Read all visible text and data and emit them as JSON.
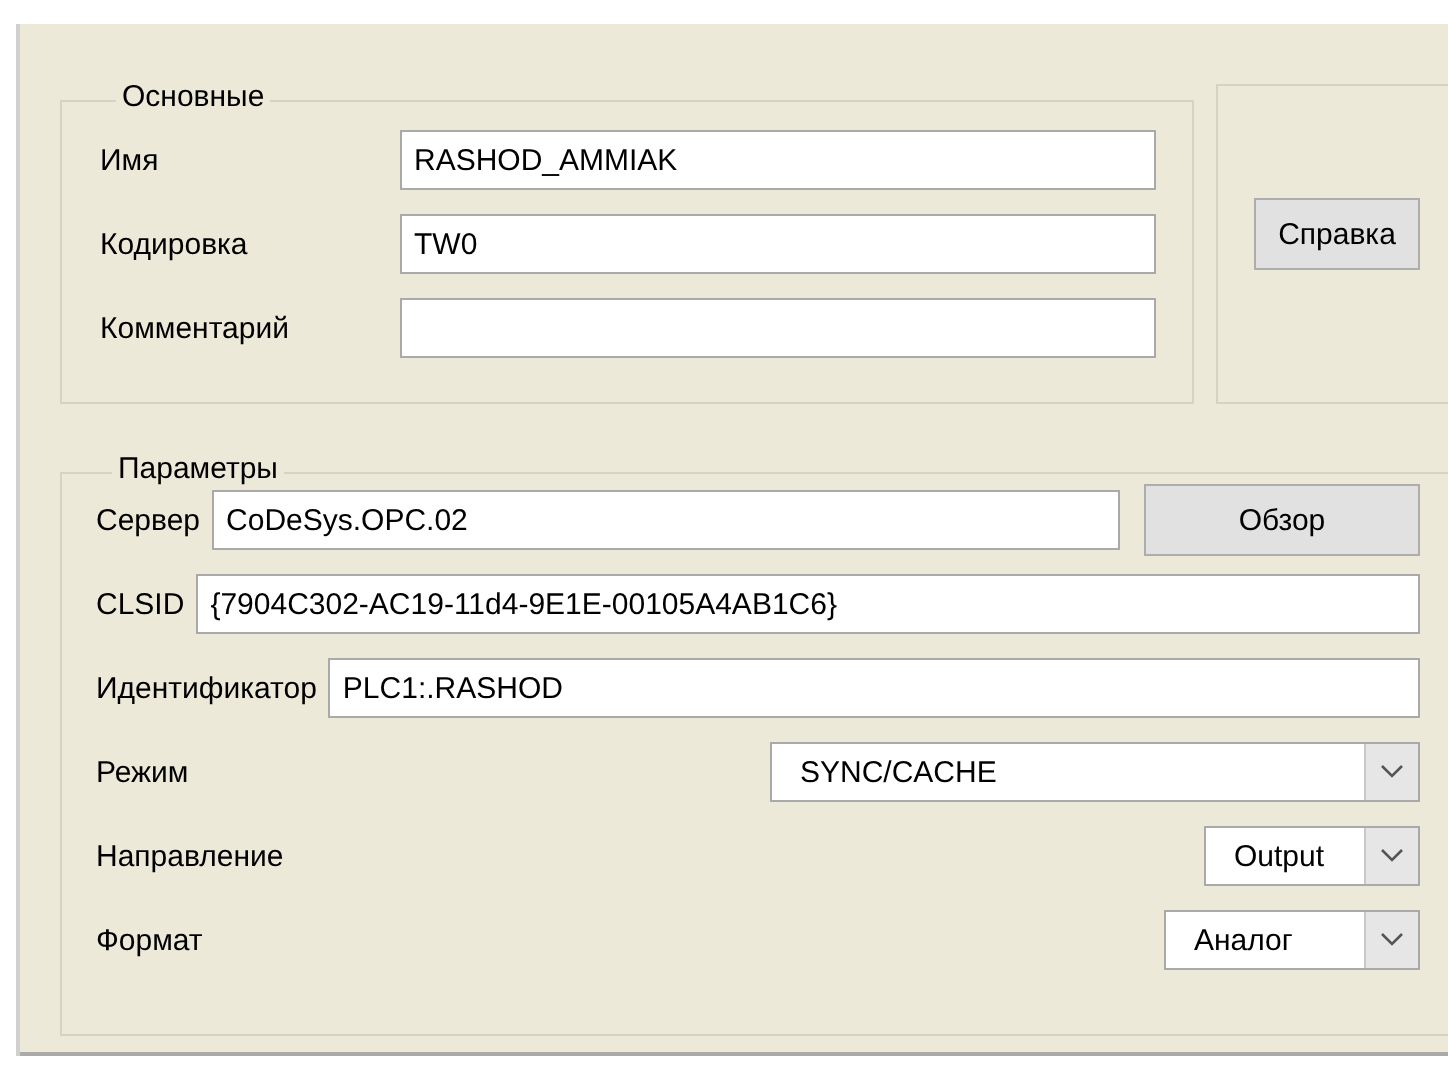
{
  "main_group": {
    "title": "Основные",
    "fields": [
      {
        "label": "Имя",
        "value": "RASHOD_AMMIAK"
      },
      {
        "label": "Кодировка",
        "value": "TW0"
      },
      {
        "label": "Комментарий"
      }
    ]
  },
  "help_button": "Справка",
  "params_group": {
    "title": "Параметры",
    "rows": [
      {
        "kind": "text",
        "label": "Сервер",
        "value": "CoDeSys.OPC.02",
        "button": "Обзор"
      },
      {
        "kind": "text",
        "label": "CLSID",
        "value": "{7904C302-AC19-11d4-9E1E-00105A4AB1C6}"
      },
      {
        "kind": "text",
        "label": "Идентификатор",
        "value": "PLC1:.RASHOD"
      },
      {
        "kind": "combo",
        "label": "Режим",
        "value": "SYNC/CACHE"
      },
      {
        "kind": "combo",
        "label": "Направление",
        "value": "Output"
      },
      {
        "kind": "combo",
        "label": "Формат",
        "value": "Аналог"
      }
    ]
  }
}
